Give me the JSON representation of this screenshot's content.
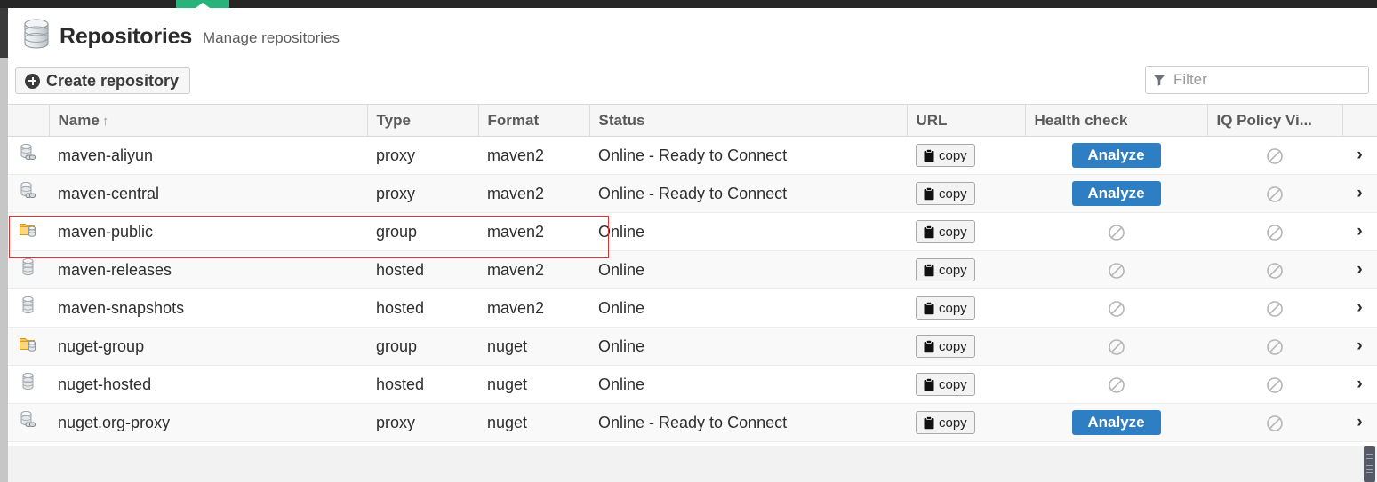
{
  "topbar": {
    "active_tab_indicator": "caret-up-icon",
    "accent_green": "#27b379",
    "bar_color": "#262626"
  },
  "header": {
    "icon": "database-icon",
    "title": "Repositories",
    "subtitle": "Manage repositories"
  },
  "toolbar": {
    "create_label": "Create repository",
    "create_icon": "plus-circle-icon",
    "filter_icon": "funnel-icon",
    "filter_placeholder": "Filter",
    "filter_value": ""
  },
  "table": {
    "columns": [
      {
        "key": "icon",
        "label": ""
      },
      {
        "key": "name",
        "label": "Name",
        "sorted": "asc",
        "sort_glyph": "↑"
      },
      {
        "key": "type",
        "label": "Type"
      },
      {
        "key": "format",
        "label": "Format"
      },
      {
        "key": "status",
        "label": "Status"
      },
      {
        "key": "url",
        "label": "URL"
      },
      {
        "key": "health",
        "label": "Health check"
      },
      {
        "key": "iq",
        "label": "IQ Policy Vi..."
      },
      {
        "key": "chev",
        "label": ""
      }
    ],
    "copy_label": "copy",
    "analyze_label": "Analyze",
    "chevron_glyph": "›",
    "rows": [
      {
        "icon": "proxy-repository-icon",
        "name": "maven-aliyun",
        "type": "proxy",
        "format": "maven2",
        "status": "Online - Ready to Connect",
        "url": "copy",
        "health": "analyze",
        "iq": "blocked",
        "highlighted": false
      },
      {
        "icon": "proxy-repository-icon",
        "name": "maven-central",
        "type": "proxy",
        "format": "maven2",
        "status": "Online - Ready to Connect",
        "url": "copy",
        "health": "analyze",
        "iq": "blocked",
        "highlighted": false
      },
      {
        "icon": "group-repository-icon",
        "name": "maven-public",
        "type": "group",
        "format": "maven2",
        "status": "Online",
        "url": "copy",
        "health": "blocked",
        "iq": "blocked",
        "highlighted": true
      },
      {
        "icon": "hosted-repository-icon",
        "name": "maven-releases",
        "type": "hosted",
        "format": "maven2",
        "status": "Online",
        "url": "copy",
        "health": "blocked",
        "iq": "blocked",
        "highlighted": false
      },
      {
        "icon": "hosted-repository-icon",
        "name": "maven-snapshots",
        "type": "hosted",
        "format": "maven2",
        "status": "Online",
        "url": "copy",
        "health": "blocked",
        "iq": "blocked",
        "highlighted": false
      },
      {
        "icon": "group-repository-icon",
        "name": "nuget-group",
        "type": "group",
        "format": "nuget",
        "status": "Online",
        "url": "copy",
        "health": "blocked",
        "iq": "blocked",
        "highlighted": false
      },
      {
        "icon": "hosted-repository-icon",
        "name": "nuget-hosted",
        "type": "hosted",
        "format": "nuget",
        "status": "Online",
        "url": "copy",
        "health": "blocked",
        "iq": "blocked",
        "highlighted": false
      },
      {
        "icon": "proxy-repository-icon",
        "name": "nuget.org-proxy",
        "type": "proxy",
        "format": "nuget",
        "status": "Online - Ready to Connect",
        "url": "copy",
        "health": "analyze",
        "iq": "blocked",
        "highlighted": false
      }
    ]
  },
  "colors": {
    "accent_blue": "#2e7ec4",
    "highlight_red": "#e03030",
    "header_bg": "#f6f6f6",
    "row_alt_bg": "#f9f9f9"
  }
}
